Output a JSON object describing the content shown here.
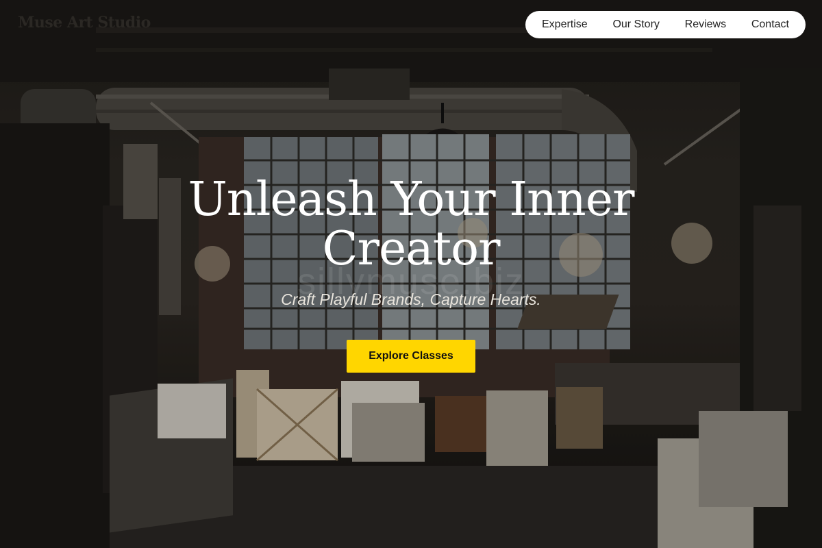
{
  "brand": {
    "name": "Muse Art Studio"
  },
  "nav": {
    "items": [
      {
        "label": "Expertise"
      },
      {
        "label": "Our Story"
      },
      {
        "label": "Reviews"
      },
      {
        "label": "Contact"
      }
    ]
  },
  "hero": {
    "headline": "Unleash Your Inner Creator",
    "subheadline": "Craft Playful Brands, Capture Hearts.",
    "cta_label": "Explore Classes",
    "watermark": "sillymuse.biz"
  },
  "colors": {
    "accent": "#ffd600",
    "nav_background": "#ffffff",
    "headline_text": "#ffffff"
  }
}
